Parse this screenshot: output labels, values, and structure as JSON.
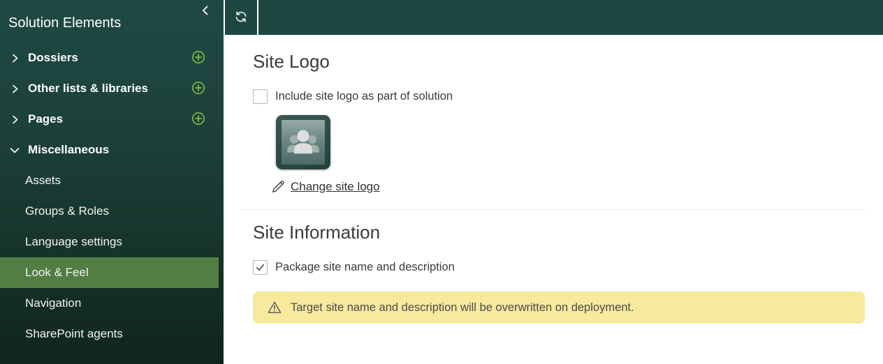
{
  "colors": {
    "sidebar_top": "#1f4944",
    "sidebar_bottom": "#0f251e",
    "topbar": "#1e4742",
    "selected_item_bg": "#527e44",
    "plus_green": "#84bd3f",
    "warning_bg": "#f7ea9f",
    "text": "#3b3a39",
    "divider": "#e8e8e8"
  },
  "sidebar": {
    "title": "Solution Elements",
    "collapse_icon": "chevron-left-icon",
    "groups": [
      {
        "label": "Dossiers",
        "expanded": false,
        "has_add": true
      },
      {
        "label": "Other lists & libraries",
        "expanded": false,
        "has_add": true
      },
      {
        "label": "Pages",
        "expanded": false,
        "has_add": true
      },
      {
        "label": "Miscellaneous",
        "expanded": true,
        "has_add": false
      }
    ],
    "items": [
      {
        "label": "Assets",
        "selected": false
      },
      {
        "label": "Groups & Roles",
        "selected": false
      },
      {
        "label": "Language settings",
        "selected": false
      },
      {
        "label": "Look & Feel",
        "selected": true
      },
      {
        "label": "Navigation",
        "selected": false
      },
      {
        "label": "SharePoint agents",
        "selected": false
      }
    ]
  },
  "toolbar": {
    "refresh_icon": "sync-icon"
  },
  "main": {
    "site_logo": {
      "heading": "Site Logo",
      "include_checkbox": {
        "label": "Include site logo as part of solution",
        "checked": false
      },
      "logo_icon": "people-group-icon",
      "change_link_label": "Change site logo"
    },
    "site_information": {
      "heading": "Site Information",
      "package_checkbox": {
        "label": "Package site name and description",
        "checked": true
      },
      "warning_message": "Target site name and description will be overwritten on deployment."
    }
  }
}
